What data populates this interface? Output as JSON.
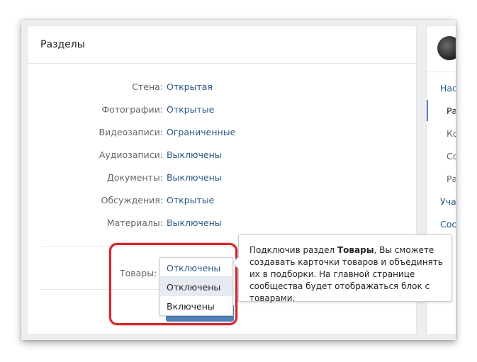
{
  "section": {
    "title": "Разделы",
    "rows": [
      {
        "label": "Стена:",
        "value": "Открытая"
      },
      {
        "label": "Фотографии:",
        "value": "Открытые"
      },
      {
        "label": "Видеозаписи:",
        "value": "Ограниченные"
      },
      {
        "label": "Аудиозаписи:",
        "value": "Выключены"
      },
      {
        "label": "Документы:",
        "value": "Выключены"
      },
      {
        "label": "Обсуждения:",
        "value": "Открытые"
      },
      {
        "label": "Материалы:",
        "value": "Выключены"
      }
    ],
    "goods": {
      "label": "Товары:",
      "selected": "Отключены",
      "options": [
        "Отключены",
        "Включены"
      ]
    }
  },
  "tooltip": {
    "before": "Подключив раздел ",
    "bold": "Товары",
    "after": ", Вы сможете создавать карточки товаров и объединять их в подборки. На главной странице сообщества будет отображаться блок с товарами."
  },
  "sidebar": {
    "items": [
      {
        "label": "Нас"
      },
      {
        "label": "Ра"
      },
      {
        "label": "Ко"
      },
      {
        "label": "Со"
      },
      {
        "label": "Ра"
      },
      {
        "label": "Уча"
      },
      {
        "label": "Соо"
      }
    ]
  },
  "colors": {
    "link": "#2a5885",
    "highlight": "#d8252b",
    "accent": "#5181b8"
  }
}
